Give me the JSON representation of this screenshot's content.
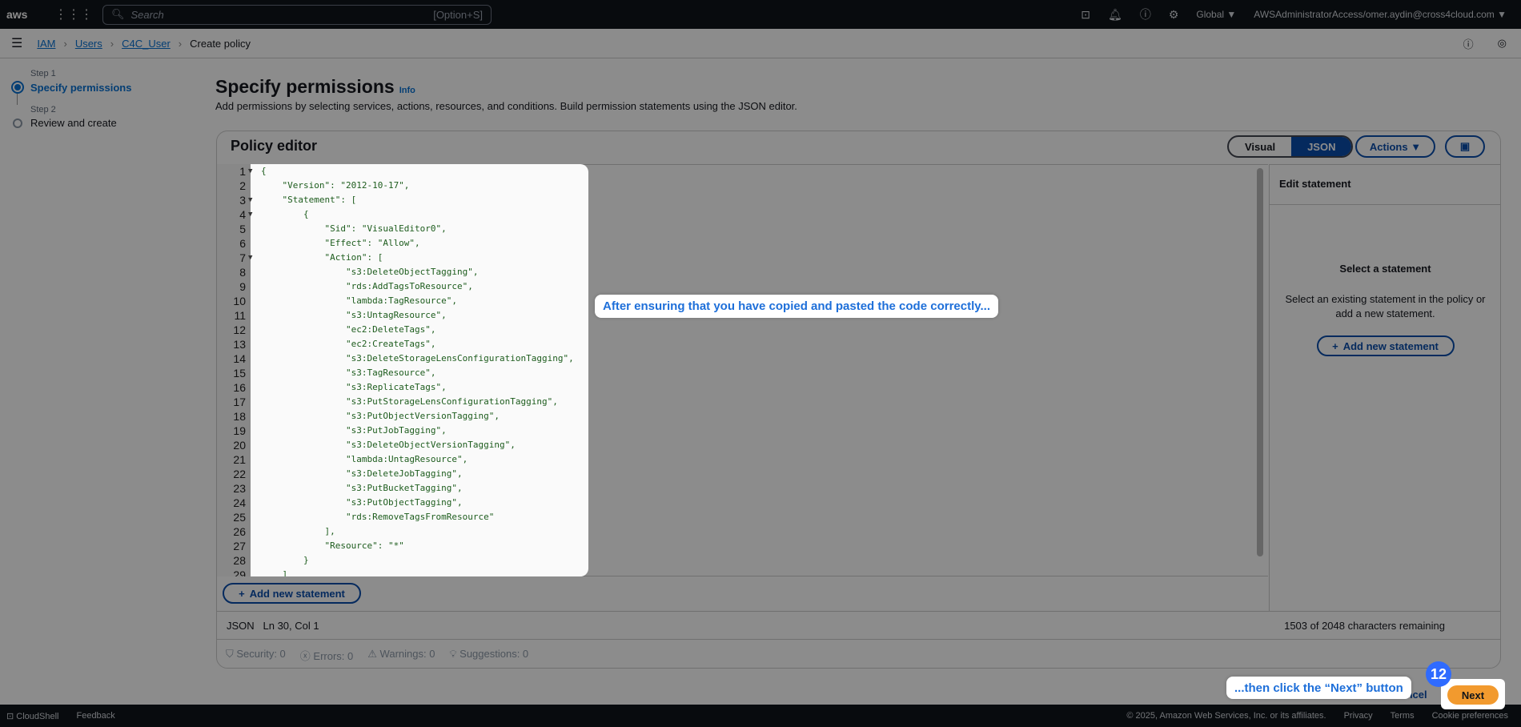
{
  "topnav": {
    "logo": "aws",
    "search_placeholder": "Search",
    "search_shortcut": "[Option+S]",
    "region": "Global ▼",
    "account": "AWSAdministratorAccess/omer.aydin@cross4cloud.com ▼"
  },
  "breadcrumb": [
    {
      "label": "IAM"
    },
    {
      "label": "Users"
    },
    {
      "label": "C4C_User"
    },
    {
      "label": "Create policy"
    }
  ],
  "steps": [
    {
      "step": "Step 1",
      "name": "Specify permissions",
      "active": true
    },
    {
      "step": "Step 2",
      "name": "Review and create",
      "active": false
    }
  ],
  "page": {
    "title": "Specify permissions",
    "info": "Info",
    "description": "Add permissions by selecting services, actions, resources, and conditions. Build permission statements using the JSON editor."
  },
  "editor": {
    "title": "Policy editor",
    "modes": [
      "Visual",
      "JSON"
    ],
    "active_mode": "JSON",
    "actions_label": "Actions ▼",
    "add_statement": "Add new statement",
    "lines": [
      "{",
      "    \"Version\": \"2012-10-17\",",
      "    \"Statement\": [",
      "        {",
      "            \"Sid\": \"VisualEditor0\",",
      "            \"Effect\": \"Allow\",",
      "            \"Action\": [",
      "                \"s3:DeleteObjectTagging\",",
      "                \"rds:AddTagsToResource\",",
      "                \"lambda:TagResource\",",
      "                \"s3:UntagResource\",",
      "                \"ec2:DeleteTags\",",
      "                \"ec2:CreateTags\",",
      "                \"s3:DeleteStorageLensConfigurationTagging\",",
      "                \"s3:TagResource\",",
      "                \"s3:ReplicateTags\",",
      "                \"s3:PutStorageLensConfigurationTagging\",",
      "                \"s3:PutObjectVersionTagging\",",
      "                \"s3:PutJobTagging\",",
      "                \"s3:DeleteObjectVersionTagging\",",
      "                \"lambda:UntagResource\",",
      "                \"s3:DeleteJobTagging\",",
      "                \"s3:PutBucketTagging\",",
      "                \"s3:PutObjectTagging\",",
      "                \"rds:RemoveTagsFromResource\"",
      "            ],",
      "            \"Resource\": \"*\"",
      "        }",
      "    ]"
    ],
    "fold_lines": [
      1,
      3,
      4,
      7
    ],
    "status_left": "JSON   Ln 30, Col 1",
    "status_right": "1503 of 2048 characters remaining",
    "checks": [
      "Security: 0",
      "Errors: 0",
      "Warnings: 0",
      "Suggestions: 0"
    ]
  },
  "edit_statement": {
    "title": "Edit statement",
    "heading": "Select a statement",
    "body": "Select an existing statement in the policy or add a new statement.",
    "button": "Add new statement"
  },
  "actions": {
    "cancel": "Cancel",
    "next": "Next"
  },
  "tutorial": {
    "tip1": "After ensuring that you have copied and pasted the code correctly...",
    "tip2": "...then click the “Next” button",
    "step": "12"
  },
  "footer": {
    "cloudshell": "CloudShell",
    "feedback": "Feedback",
    "copyright": "© 2025, Amazon Web Services, Inc. or its affiliates.",
    "links": [
      "Privacy",
      "Terms",
      "Cookie preferences"
    ]
  },
  "colors": {
    "accent": "#0a4dab",
    "next": "#f29a2e",
    "tip": "#1e6fd9"
  }
}
